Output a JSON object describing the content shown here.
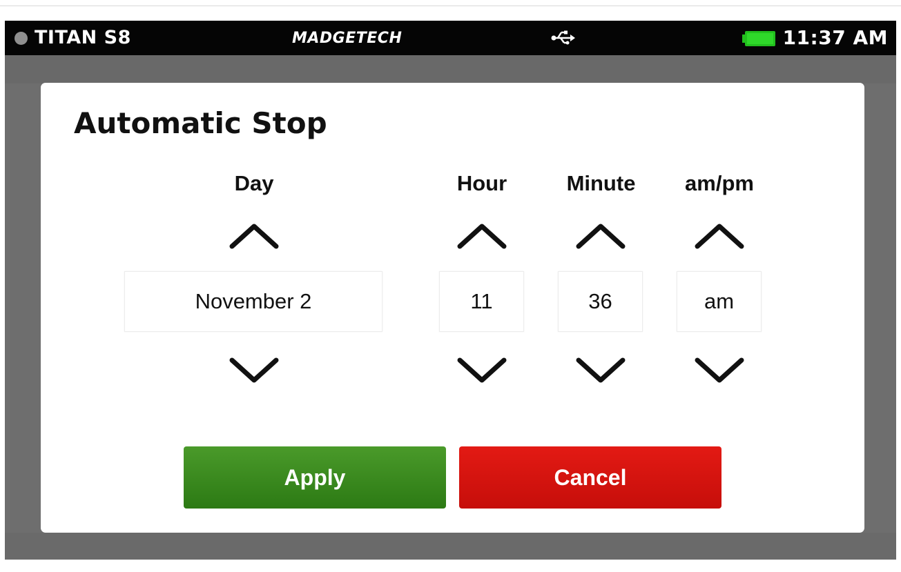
{
  "status_bar": {
    "device_name": "TITAN S8",
    "brand": "MADGETECH",
    "time": "11:37 AM",
    "status_dot_icon": "status-dot-icon",
    "usb_icon": "usb-icon",
    "battery_icon": "battery-icon",
    "battery_color": "#22c01e"
  },
  "dialog": {
    "title": "Automatic Stop",
    "columns": {
      "day": {
        "label": "Day",
        "value": "November 2"
      },
      "hour": {
        "label": "Hour",
        "value": "11"
      },
      "minute": {
        "label": "Minute",
        "value": "36"
      },
      "ampm": {
        "label": "am/pm",
        "value": "am"
      }
    },
    "up_icon": "chevron-up-icon",
    "down_icon": "chevron-down-icon",
    "apply_label": "Apply",
    "cancel_label": "Cancel",
    "apply_color": "#3a8a1f",
    "cancel_color": "#d8120e"
  }
}
